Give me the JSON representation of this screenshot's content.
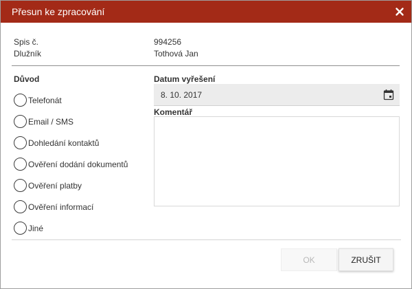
{
  "dialog": {
    "title": "Přesun ke zpracování",
    "close_icon": "close-icon"
  },
  "info": {
    "spis_label": "Spis č.",
    "spis_value": "994256",
    "dluznik_label": "Dlužník",
    "dluznik_value": "Tothová Jan"
  },
  "reason": {
    "label": "Důvod",
    "options": [
      "Telefonát",
      "Email / SMS",
      "Dohledání kontaktů",
      "Ověření dodání dokumentů",
      "Ověření platby",
      "Ověření informací",
      "Jiné"
    ]
  },
  "resolution": {
    "date_label": "Datum vyřešení",
    "date_value": "8. 10. 2017",
    "calendar_icon": "calendar-icon"
  },
  "comment": {
    "label": "Komentář",
    "value": ""
  },
  "buttons": {
    "ok_label": "OK",
    "cancel_label": "Zrušit"
  },
  "colors": {
    "titlebar": "#a32a17",
    "date_field_bg": "#ececec"
  }
}
